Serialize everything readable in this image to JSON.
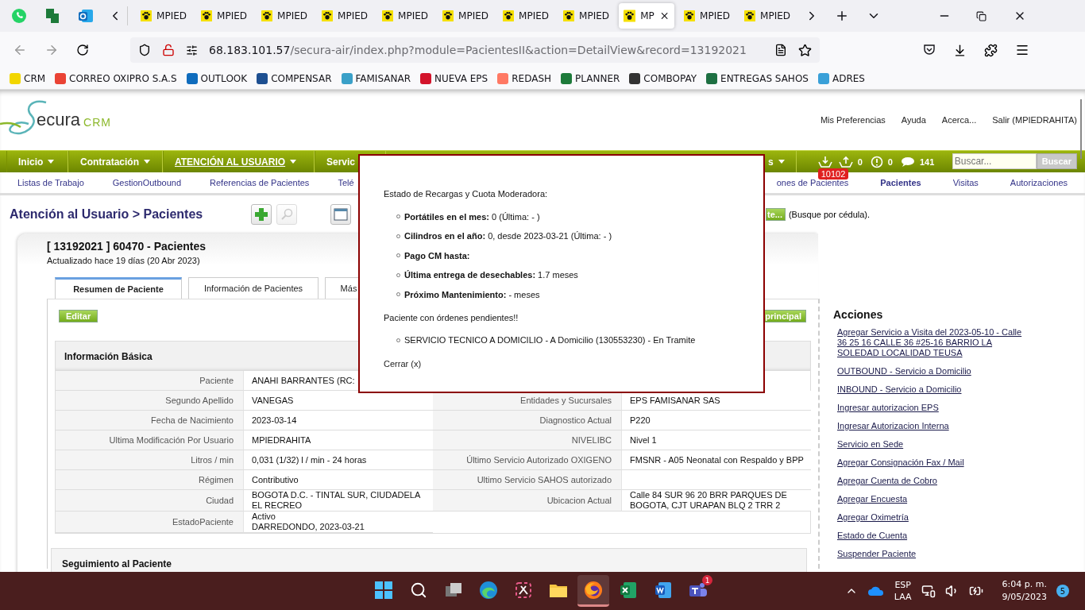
{
  "browser": {
    "tabs": [
      {
        "label": "MPIED",
        "selected": false
      },
      {
        "label": "MPIED",
        "selected": false
      },
      {
        "label": "MPIED",
        "selected": false
      },
      {
        "label": "MPIED",
        "selected": false
      },
      {
        "label": "MPIED",
        "selected": false
      },
      {
        "label": "MPIED",
        "selected": false
      },
      {
        "label": "MPIED",
        "selected": false
      },
      {
        "label": "MPIED",
        "selected": false
      },
      {
        "label": "MP",
        "selected": true
      },
      {
        "label": "MPIED",
        "selected": false
      },
      {
        "label": "MPIED",
        "selected": false
      }
    ],
    "address": {
      "host": "68.183.101.57",
      "path": "/secura-air/index.php?module=PacientesII&action=DetailView&record=13192021"
    },
    "bookmarks": [
      {
        "label": "CRM",
        "color": "#f2d600"
      },
      {
        "label": "CORREO OXIPRO S.A.S",
        "color": "#ea4335"
      },
      {
        "label": "OUTLOOK",
        "color": "#0f6cbd"
      },
      {
        "label": "COMPENSAR",
        "color": "#1d4f91"
      },
      {
        "label": "FAMISANAR",
        "color": "#3aa0c8"
      },
      {
        "label": "NUEVA EPS",
        "color": "#d3132b"
      },
      {
        "label": "REDASH",
        "color": "#ff7964"
      },
      {
        "label": "PLANNER",
        "color": "#1d7a3a"
      },
      {
        "label": "COMBOPAY",
        "color": "#333333"
      },
      {
        "label": "ENTREGAS SAHOS",
        "color": "#1d6f42"
      },
      {
        "label": "ADRES",
        "color": "#3aa0d8"
      }
    ]
  },
  "header": {
    "logo": {
      "text": "ecura",
      "suffix": "CRM"
    },
    "links": [
      "Mis Preferencias",
      "Ayuda",
      "Acerca...",
      "Salir (MPIEDRAHITA)"
    ]
  },
  "nav": {
    "items": [
      {
        "label": "Inicio",
        "selected": false
      },
      {
        "label": "Contratación",
        "selected": false
      },
      {
        "label": "ATENCIÓN AL USUARIO",
        "selected": true
      },
      {
        "label": "Servic",
        "selected": false
      }
    ],
    "end_item": "s",
    "counters": [
      {
        "kind": "inbox",
        "badge": "10102"
      },
      {
        "kind": "outbox",
        "count": "0"
      },
      {
        "kind": "alert",
        "count": "0"
      },
      {
        "kind": "chat",
        "count": "141"
      }
    ],
    "search": {
      "placeholder": "Buscar...",
      "button": "Buscar"
    }
  },
  "subnav": {
    "left": [
      {
        "label": "Listas de Trabajo",
        "selected": false
      },
      {
        "label": "GestionOutbound",
        "selected": false
      },
      {
        "label": "Referencias de Pacientes",
        "selected": false
      },
      {
        "label": "Telé",
        "selected": false
      }
    ],
    "right": [
      {
        "label": "ones de Pacientes",
        "selected": false
      },
      {
        "label": "Pacientes",
        "selected": true
      },
      {
        "label": "Visitas",
        "selected": false
      },
      {
        "label": "Autorizaciones",
        "selected": false
      }
    ]
  },
  "page_title": "Atención al Usuario > Pacientes",
  "search_button": "te...",
  "search_hint": "(Busque por cédula).",
  "record": {
    "title": "[ 13192021 ] 60470 - Pacientes",
    "updated": "Actualizado hace 19 días (20 Abr 2023)",
    "tabs": [
      {
        "label": "Resumen de Paciente",
        "selected": true
      },
      {
        "label": "Información de Pacientes",
        "selected": false
      },
      {
        "label": "Más",
        "selected": false
      }
    ],
    "edit_button": "Editar",
    "principal_button": "principal",
    "basic_title": "Información Básica",
    "rows": [
      {
        "field": "Paciente",
        "value": "ANAHI BARRANTES (RC:"
      },
      {
        "field": "Segundo Apellido",
        "value": "VANEGAS",
        "field_right": "Entidades y Sucursales",
        "value_right": "EPS FAMISANAR SAS"
      },
      {
        "field": "Fecha de Nacimiento",
        "value": "2023-03-14",
        "field_right": "Diagnostico Actual",
        "value_right": "P220"
      },
      {
        "field": "Ultima Modificación Por Usuario",
        "value": "MPIEDRAHITA",
        "field_right": "NIVELIBC",
        "value_right": "Nivel 1"
      },
      {
        "field": "Litros / min",
        "value": "0,031 (1/32) l / min - 24 horas",
        "field_right": "Último Servicio Autorizado OXIGENO",
        "value_right": "FMSNR - A05 Neonatal con Respaldo y BPP"
      },
      {
        "field": "Régimen",
        "value": "Contributivo",
        "field_right": "Ultimo Servicio SAHOS autorizado"
      },
      {
        "field": "Ciudad",
        "value": "BOGOTA D.C. - TINTAL SUR, CIUDADELA EL RECREO",
        "field_right": "Ubicacion Actual",
        "value_right": "Calle 84 SUR 96 20 BRR PARQUES DE BOGOTA, CJT URAPAN BLQ 2 TRR 2"
      },
      {
        "field": "EstadoPaciente",
        "value": [
          "Activo",
          "DARREDONDO, 2023-03-21"
        ]
      }
    ],
    "follow_title": "Seguimiento al Paciente"
  },
  "actions": {
    "title": "Acciones",
    "links": [
      "Agregar Servicio a Visita del 2023-05-10 - Calle 36 25 16 CALLE 36 #25-16 BARRIO LA SOLEDAD LOCALIDAD TEUSA",
      "OUTBOUND - Servicio a Domicilio",
      "INBOUND - Servicio a Domicilio",
      "Ingresar autorizacion EPS",
      "Ingresar Autorizacion Interna",
      "Servicio en Sede",
      "Agregar Consignación Fax / Mail",
      "Agregar Cuenta de Cobro",
      "Agregar Encuesta",
      "Agregar Oximetría",
      "Estado de Cuenta",
      "Suspender Paciente"
    ]
  },
  "modal": {
    "heading": "Estado de Recargas y Cuota Moderadora:",
    "items": [
      "**Portátiles en el mes:** 0 (Última: - )",
      "**Cilindros en el año:** 0, desde 2023-03-21 (Última: - )",
      "**Pago CM hasta:**",
      "**Última entrega de desechables:** 1.7 meses",
      "**Próximo Mantenimiento:** - meses"
    ],
    "pending_title": "Paciente con órdenes pendientes!!",
    "orders": [
      "SERVICIO TECNICO A DOMICILIO - A Domicilio (130553230) - En Tramite"
    ],
    "close": "Cerrar (x)"
  },
  "taskbar": {
    "apps": [
      {
        "kind": "start",
        "selected": false
      },
      {
        "kind": "search",
        "selected": false
      },
      {
        "kind": "taskview",
        "selected": false
      },
      {
        "kind": "edge",
        "selected": false
      },
      {
        "kind": "snip",
        "selected": false
      },
      {
        "kind": "folder",
        "selected": false
      },
      {
        "kind": "firefox",
        "selected": true
      },
      {
        "kind": "excel",
        "selected": false
      },
      {
        "kind": "word",
        "selected": false
      },
      {
        "kind": "teams",
        "selected": false,
        "badge": "1"
      }
    ],
    "lang": [
      "ESP",
      "LAA"
    ],
    "time": "6:04 p. m.",
    "date": "9/05/2023",
    "notifications": "5"
  }
}
